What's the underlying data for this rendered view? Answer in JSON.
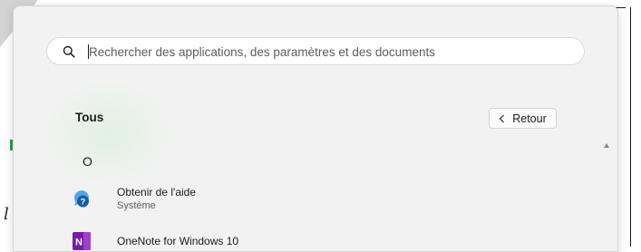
{
  "search": {
    "placeholder": "Rechercher des applications, des paramètres et des documents",
    "value": ""
  },
  "all_apps": {
    "title": "Tous",
    "back_label": "Retour",
    "letter": "O",
    "apps": [
      {
        "name": "Obtenir de l'aide",
        "subtitle": "Système",
        "icon": "get-help-icon"
      },
      {
        "name": "OneNote for Windows 10",
        "icon": "onenote-icon"
      }
    ]
  },
  "colors": {
    "panel": "#f2f2f2",
    "onenote": "#7719aa",
    "help": "#1f6fc0"
  }
}
